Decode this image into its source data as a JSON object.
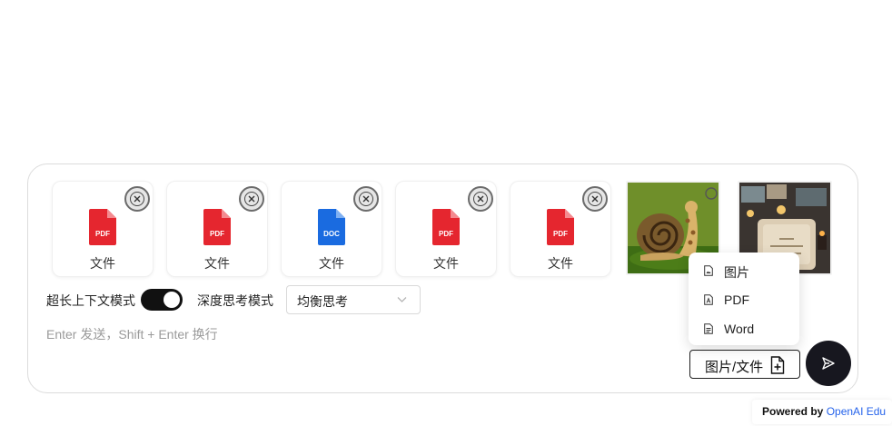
{
  "attachments": [
    {
      "type": "PDF",
      "label": "文件",
      "color": "#e5262f"
    },
    {
      "type": "PDF",
      "label": "文件",
      "color": "#e5262f"
    },
    {
      "type": "DOC",
      "label": "文件",
      "color": "#1a6be0"
    },
    {
      "type": "PDF",
      "label": "文件",
      "color": "#e5262f"
    },
    {
      "type": "PDF",
      "label": "文件",
      "color": "#e5262f"
    }
  ],
  "images": [
    {
      "name": "snail-giraffe-image"
    },
    {
      "name": "higher-education-cake-image"
    }
  ],
  "controls": {
    "long_context_label": "超长上下文模式",
    "long_context_enabled": true,
    "deep_thinking_label": "深度思考模式",
    "thinking_mode_value": "均衡思考"
  },
  "input": {
    "placeholder": "Enter 发送，Shift + Enter 换行"
  },
  "upload_menu": {
    "items": [
      {
        "label": "图片",
        "icon": "image-file-icon"
      },
      {
        "label": "PDF",
        "icon": "pdf-file-icon"
      },
      {
        "label": "Word",
        "icon": "word-file-icon"
      }
    ],
    "button_label": "图片/文件",
    "button_icon": "file-add-icon"
  },
  "send": {
    "icon": "send-icon"
  },
  "footer": {
    "powered_prefix": "Powered by",
    "brand": "OpenAI Edu"
  },
  "colors": {
    "pdf": "#e5262f",
    "doc": "#1a6be0",
    "send_bg": "#17171f",
    "brand": "#2563eb"
  }
}
